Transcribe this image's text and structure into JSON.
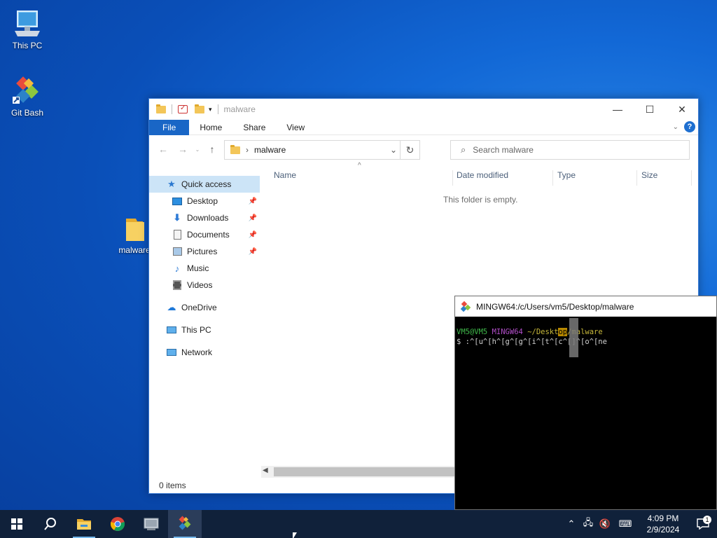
{
  "desktop": {
    "icons": [
      {
        "label": "This PC",
        "icon": "this-pc-icon"
      },
      {
        "label": "Git Bash",
        "icon": "git-bash-icon"
      },
      {
        "label": "malware",
        "icon": "folder-icon"
      }
    ]
  },
  "explorer": {
    "title": "malware",
    "ribbon": {
      "tabs": [
        "File",
        "Home",
        "Share",
        "View"
      ]
    },
    "address": {
      "path": "malware"
    },
    "search": {
      "placeholder": "Search malware"
    },
    "nav": {
      "quick_access": "Quick access",
      "items": [
        {
          "label": "Desktop",
          "icon": "desktop-icon",
          "pinned": true
        },
        {
          "label": "Downloads",
          "icon": "download-icon",
          "pinned": true
        },
        {
          "label": "Documents",
          "icon": "documents-icon",
          "pinned": true
        },
        {
          "label": "Pictures",
          "icon": "pictures-icon",
          "pinned": true
        },
        {
          "label": "Music",
          "icon": "music-icon",
          "pinned": false
        },
        {
          "label": "Videos",
          "icon": "videos-icon",
          "pinned": false
        }
      ],
      "onedrive": "OneDrive",
      "this_pc": "This PC",
      "network": "Network"
    },
    "columns": [
      "Name",
      "Date modified",
      "Type",
      "Size"
    ],
    "empty_message": "This folder is empty.",
    "status": "0 items"
  },
  "terminal": {
    "title": "MINGW64:/c/Users/vm5/Desktop/malware",
    "prompt_user": "VM5@VM5",
    "prompt_env": "MINGW64",
    "prompt_path_a": "~/Deskt",
    "prompt_path_hl": "op",
    "prompt_path_b": "/malware",
    "command_line": "$ :^[u^[h^[g^[g^[i^[t^[c^[]^[o^[ne"
  },
  "taskbar": {
    "apps": [
      "start-icon",
      "search-icon",
      "file-explorer-icon",
      "chrome-icon",
      "system-tool-icon",
      "git-bash-icon"
    ],
    "clock_time": "4:09 PM",
    "clock_date": "2/9/2024",
    "notifications": "1"
  }
}
